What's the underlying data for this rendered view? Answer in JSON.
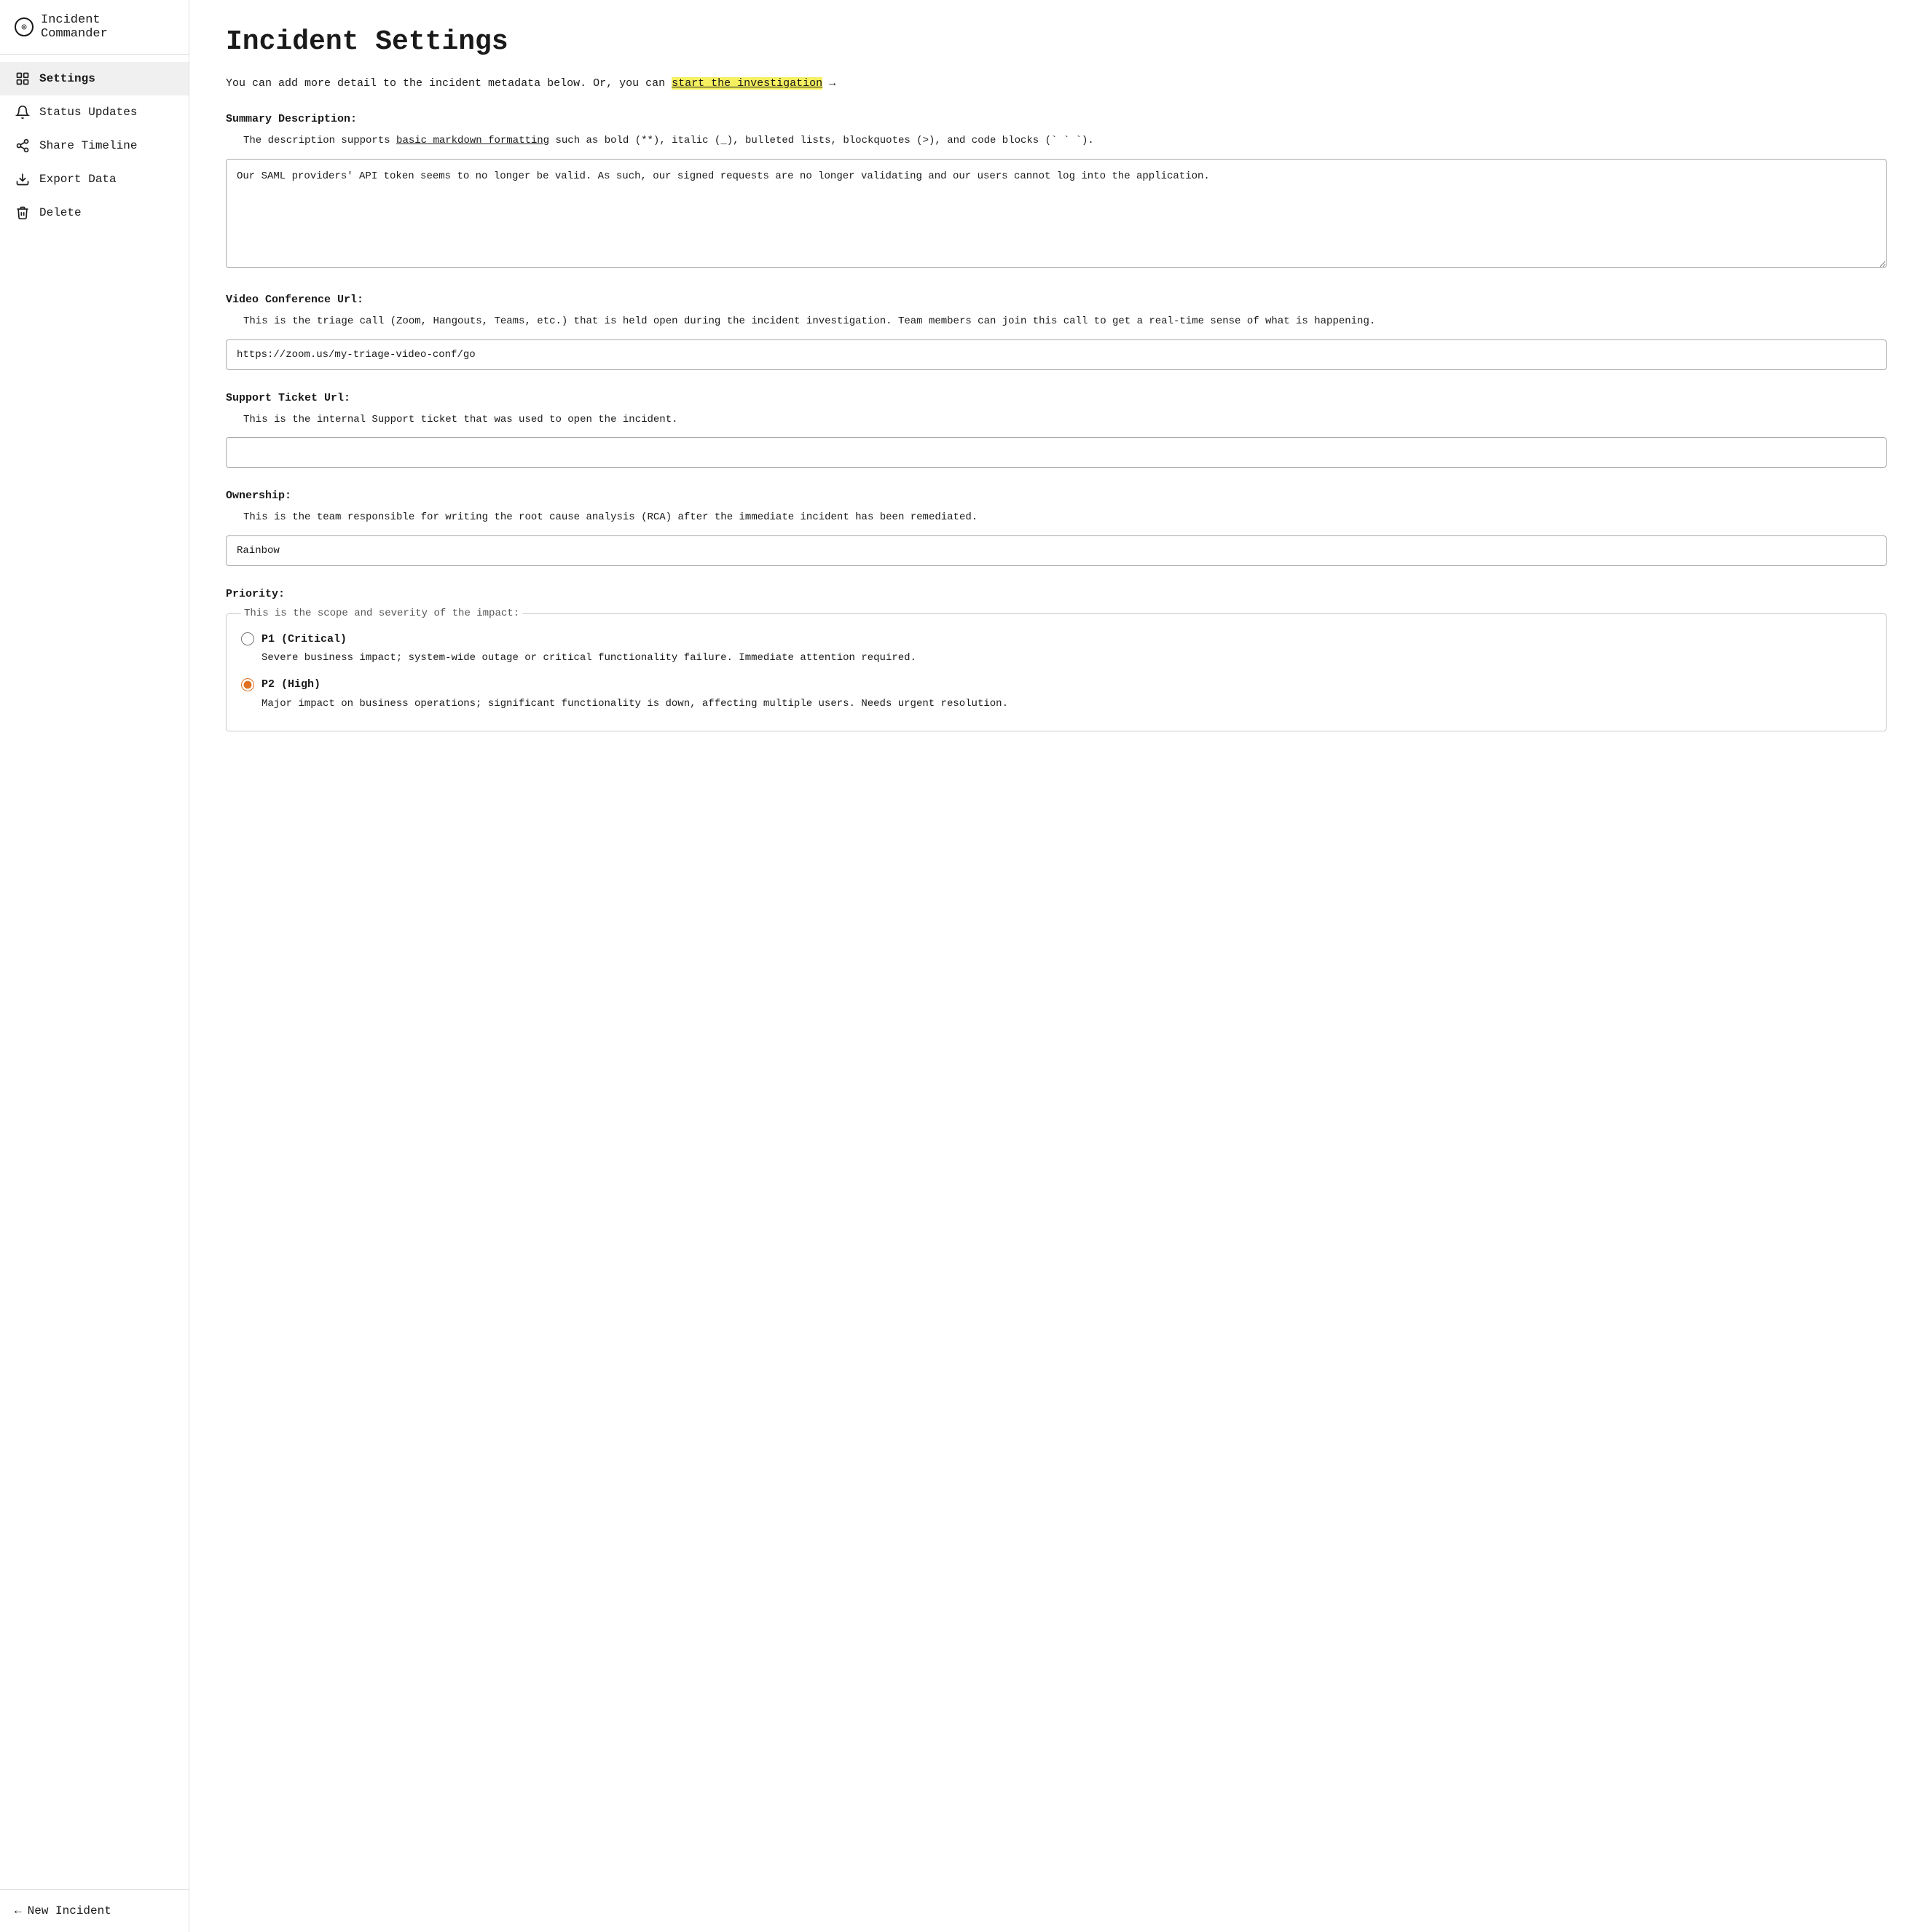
{
  "app": {
    "name": "Incident Commander",
    "icon": "⊙"
  },
  "sidebar": {
    "nav_items": [
      {
        "id": "settings",
        "label": "Settings",
        "icon": "⚙",
        "active": true
      },
      {
        "id": "status-updates",
        "label": "Status Updates",
        "icon": "🔔"
      },
      {
        "id": "share-timeline",
        "label": "Share Timeline",
        "icon": "📋"
      },
      {
        "id": "export-data",
        "label": "Export Data",
        "icon": "⬇"
      },
      {
        "id": "delete",
        "label": "Delete",
        "icon": "🗑"
      }
    ],
    "new_incident_label": "New Incident",
    "new_incident_arrow": "←"
  },
  "main": {
    "page_title": "Incident Settings",
    "intro_text_before": "You can add more detail to the incident metadata below. Or, you can",
    "intro_link_text": "start the investigation",
    "intro_text_after": "→",
    "sections": {
      "summary": {
        "label": "Summary Description:",
        "desc_before": "The description supports",
        "desc_link": "basic markdown formatting",
        "desc_after": "such as bold (**), italic (_), bulleted lists, blockquotes (>), and code blocks (` ` `).",
        "value": "Our SAML providers' API token seems to no longer be valid. As such, our signed requests are no longer validating and our users cannot log into the application."
      },
      "video_conf": {
        "label": "Video Conference Url:",
        "desc": "This is the triage call (Zoom, Hangouts, Teams, etc.) that is held open during the incident investigation. Team members can join this call to get a real-time sense of what is happening.",
        "value": "https://zoom.us/my-triage-video-conf/go"
      },
      "support_ticket": {
        "label": "Support Ticket Url:",
        "desc": "This is the internal Support ticket that was used to open the incident.",
        "value": ""
      },
      "ownership": {
        "label": "Ownership:",
        "desc": "This is the team responsible for writing the root cause analysis (RCA) after the immediate incident has been remediated.",
        "value": "Rainbow"
      },
      "priority": {
        "label": "Priority:",
        "legend": "This is the scope and severity of the impact:",
        "options": [
          {
            "id": "p1",
            "label": "P1 (Critical)",
            "desc": "Severe business impact; system-wide outage or critical functionality failure. Immediate attention required.",
            "checked": false
          },
          {
            "id": "p2",
            "label": "P2 (High)",
            "desc": "Major impact on business operations; significant functionality is down, affecting multiple users. Needs urgent resolution.",
            "checked": true
          }
        ]
      }
    }
  }
}
